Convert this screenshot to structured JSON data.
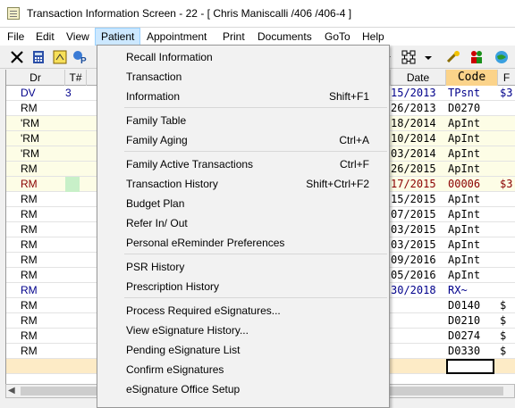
{
  "window": {
    "title": "Transaction Information Screen - 22 - [ Chris Maniscalli /406 /406-4 ]"
  },
  "menubar": [
    "File",
    "Edit",
    "View",
    "Patient",
    "Appointment",
    "Print",
    "Documents",
    "GoTo",
    "Help"
  ],
  "grid": {
    "headers": {
      "dr": "Dr",
      "t": "T#",
      "date": "Date",
      "code": "Code",
      "f": "F"
    },
    "rows": [
      {
        "dr": "DV",
        "t": "3",
        "date": "15/2013",
        "code": "TPsnt",
        "f": "$3",
        "style": "blue",
        "bg": "#ffffff"
      },
      {
        "dr": "RM",
        "t": "",
        "date": "26/2013",
        "code": "D0270",
        "f": "",
        "style": "black",
        "bg": "#ffffff"
      },
      {
        "dr": "'RM",
        "t": "",
        "date": "18/2014",
        "code": "ApInt",
        "f": "",
        "style": "black",
        "bg": "#fdfde6"
      },
      {
        "dr": "'RM",
        "t": "",
        "date": "10/2014",
        "code": "ApInt",
        "f": "",
        "style": "black",
        "bg": "#fdfde6"
      },
      {
        "dr": "'RM",
        "t": "",
        "date": "03/2014",
        "code": "ApInt",
        "f": "",
        "style": "black",
        "bg": "#fdfde6"
      },
      {
        "dr": "RM",
        "t": "",
        "date": "26/2015",
        "code": "ApInt",
        "f": "",
        "style": "black",
        "bg": "#fdfde6"
      },
      {
        "dr": "RM",
        "t": "",
        "date": "17/2015",
        "code": "00006",
        "f": "$3",
        "style": "maroon",
        "bg": "#fdfde6"
      },
      {
        "dr": "RM",
        "t": "",
        "date": "15/2015",
        "code": "ApInt",
        "f": "",
        "style": "black",
        "bg": "#ffffff"
      },
      {
        "dr": "RM",
        "t": "",
        "date": "07/2015",
        "code": "ApInt",
        "f": "",
        "style": "black",
        "bg": "#ffffff"
      },
      {
        "dr": "RM",
        "t": "",
        "date": "03/2015",
        "code": "ApInt",
        "f": "",
        "style": "black",
        "bg": "#ffffff"
      },
      {
        "dr": "RM",
        "t": "",
        "date": "03/2015",
        "code": "ApInt",
        "f": "",
        "style": "black",
        "bg": "#ffffff"
      },
      {
        "dr": "RM",
        "t": "",
        "date": "09/2016",
        "code": "ApInt",
        "f": "",
        "style": "black",
        "bg": "#ffffff"
      },
      {
        "dr": "RM",
        "t": "",
        "date": "05/2016",
        "code": "ApInt",
        "f": "",
        "style": "black",
        "bg": "#ffffff"
      },
      {
        "dr": "RM",
        "t": "",
        "date": "30/2018",
        "code": "RX~",
        "f": "",
        "style": "blue",
        "bg": "#ffffff"
      },
      {
        "dr": "RM",
        "t": "",
        "date": "",
        "code": "D0140",
        "f": "$",
        "style": "black",
        "bg": "#ffffff"
      },
      {
        "dr": "RM",
        "t": "",
        "date": "",
        "code": "D0210",
        "f": "$",
        "style": "black",
        "bg": "#ffffff"
      },
      {
        "dr": "RM",
        "t": "",
        "date": "",
        "code": "D0274",
        "f": "$",
        "style": "black",
        "bg": "#ffffff"
      },
      {
        "dr": "RM",
        "t": "",
        "date": "",
        "code": "D0330",
        "f": "$",
        "style": "black",
        "bg": "#ffffff"
      },
      {
        "dr": "",
        "t": "",
        "date": "",
        "code": "",
        "f": "",
        "style": "black",
        "bg": "#fdebc6"
      },
      {
        "dr": "",
        "t": "",
        "date": "",
        "code": "",
        "f": "",
        "style": "black",
        "bg": "#ffffff"
      }
    ]
  },
  "patient_menu": {
    "items": [
      {
        "label": "Recall Information",
        "shortcut": ""
      },
      {
        "label": "Transaction",
        "shortcut": ""
      },
      {
        "label": "Information",
        "shortcut": "Shift+F1"
      },
      {
        "sep": true
      },
      {
        "label": "Family Table",
        "shortcut": ""
      },
      {
        "label": "Family Aging",
        "shortcut": "Ctrl+A"
      },
      {
        "sep": true
      },
      {
        "label": "Family Active Transactions",
        "shortcut": "Ctrl+F"
      },
      {
        "label": "Transaction History",
        "shortcut": "Shift+Ctrl+F2"
      },
      {
        "label": "Budget Plan",
        "shortcut": ""
      },
      {
        "label": "Refer In/ Out",
        "shortcut": ""
      },
      {
        "label": "Personal eReminder Preferences",
        "shortcut": ""
      },
      {
        "sep": true
      },
      {
        "label": "PSR History",
        "shortcut": ""
      },
      {
        "label": "Prescription History",
        "shortcut": ""
      },
      {
        "sep": true
      },
      {
        "label": "Process Required eSignatures...",
        "shortcut": ""
      },
      {
        "label": "View eSignature History...",
        "shortcut": ""
      },
      {
        "label": "Pending eSignature List",
        "shortcut": ""
      },
      {
        "label": "Confirm eSignatures",
        "shortcut": ""
      },
      {
        "label": "eSignature Office Setup",
        "shortcut": ""
      }
    ]
  },
  "colors": {
    "menu_highlight": "#cce8ff",
    "code_header": "#fbd38a",
    "blue_text": "#00008b",
    "maroon_text": "#8b0000",
    "t_cell_green": "#c8f0c8"
  }
}
